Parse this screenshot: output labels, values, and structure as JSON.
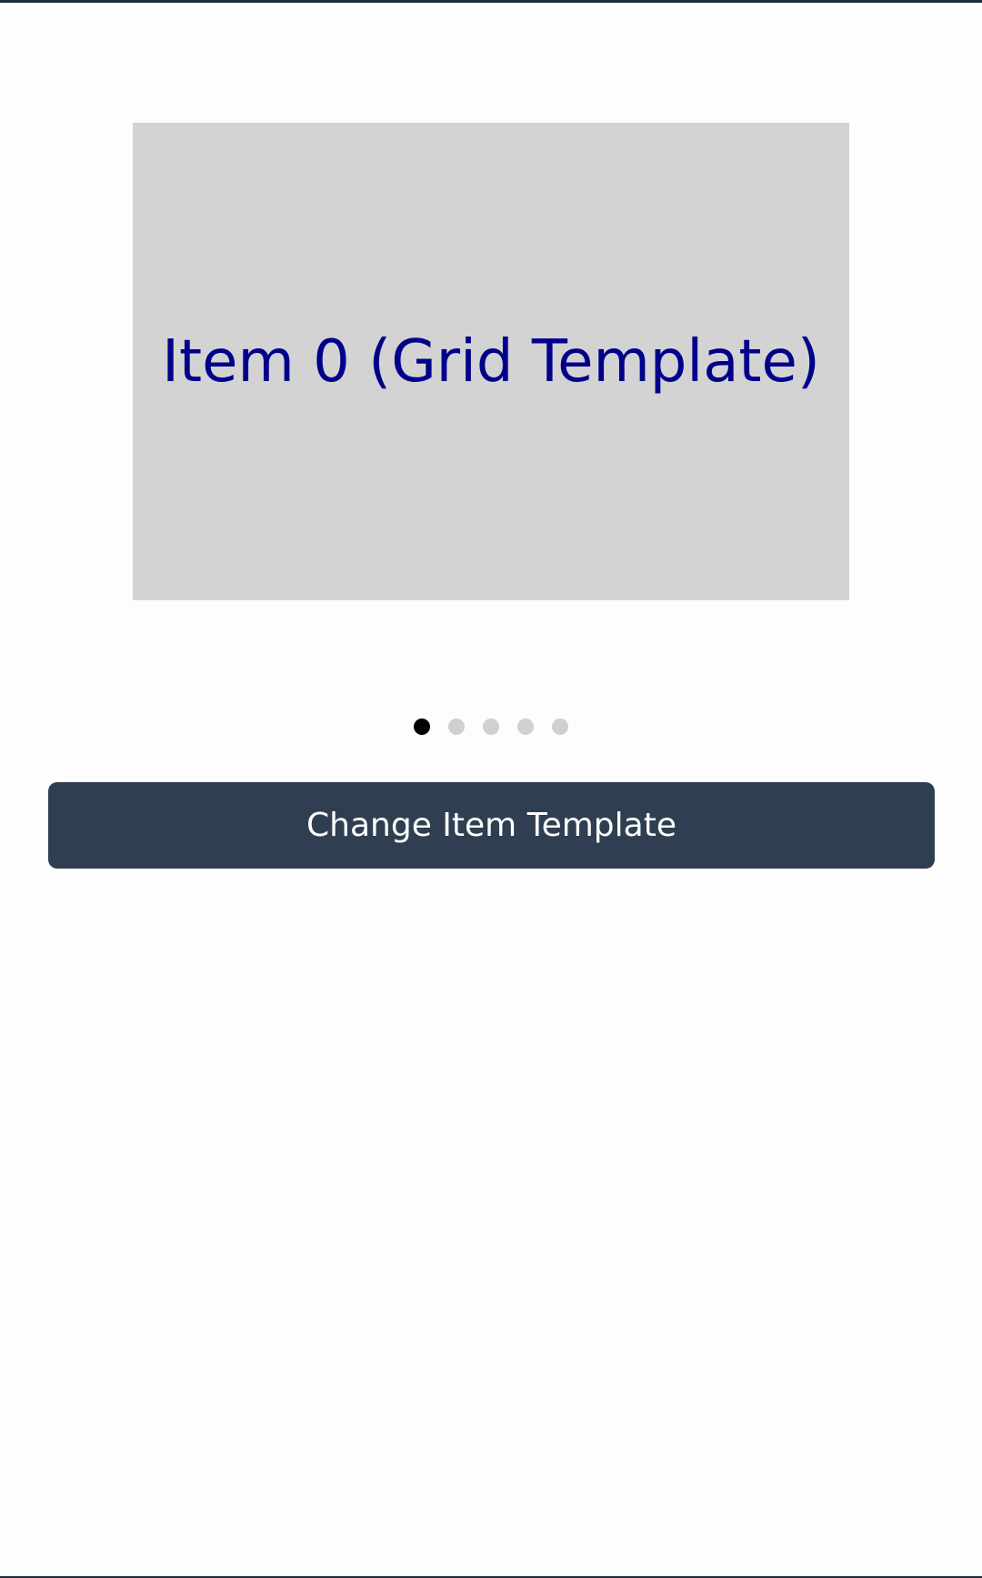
{
  "carousel": {
    "current_item_label": "Item 0 (Grid Template)",
    "item_count": 5,
    "active_index": 0,
    "colors": {
      "item_background": "#d3d3d3",
      "item_text": "#00008b",
      "indicator_active": "#000000",
      "indicator_inactive": "#d0d0d0"
    }
  },
  "actions": {
    "change_template_label": "Change Item Template",
    "button_color": "#2f3f51"
  }
}
